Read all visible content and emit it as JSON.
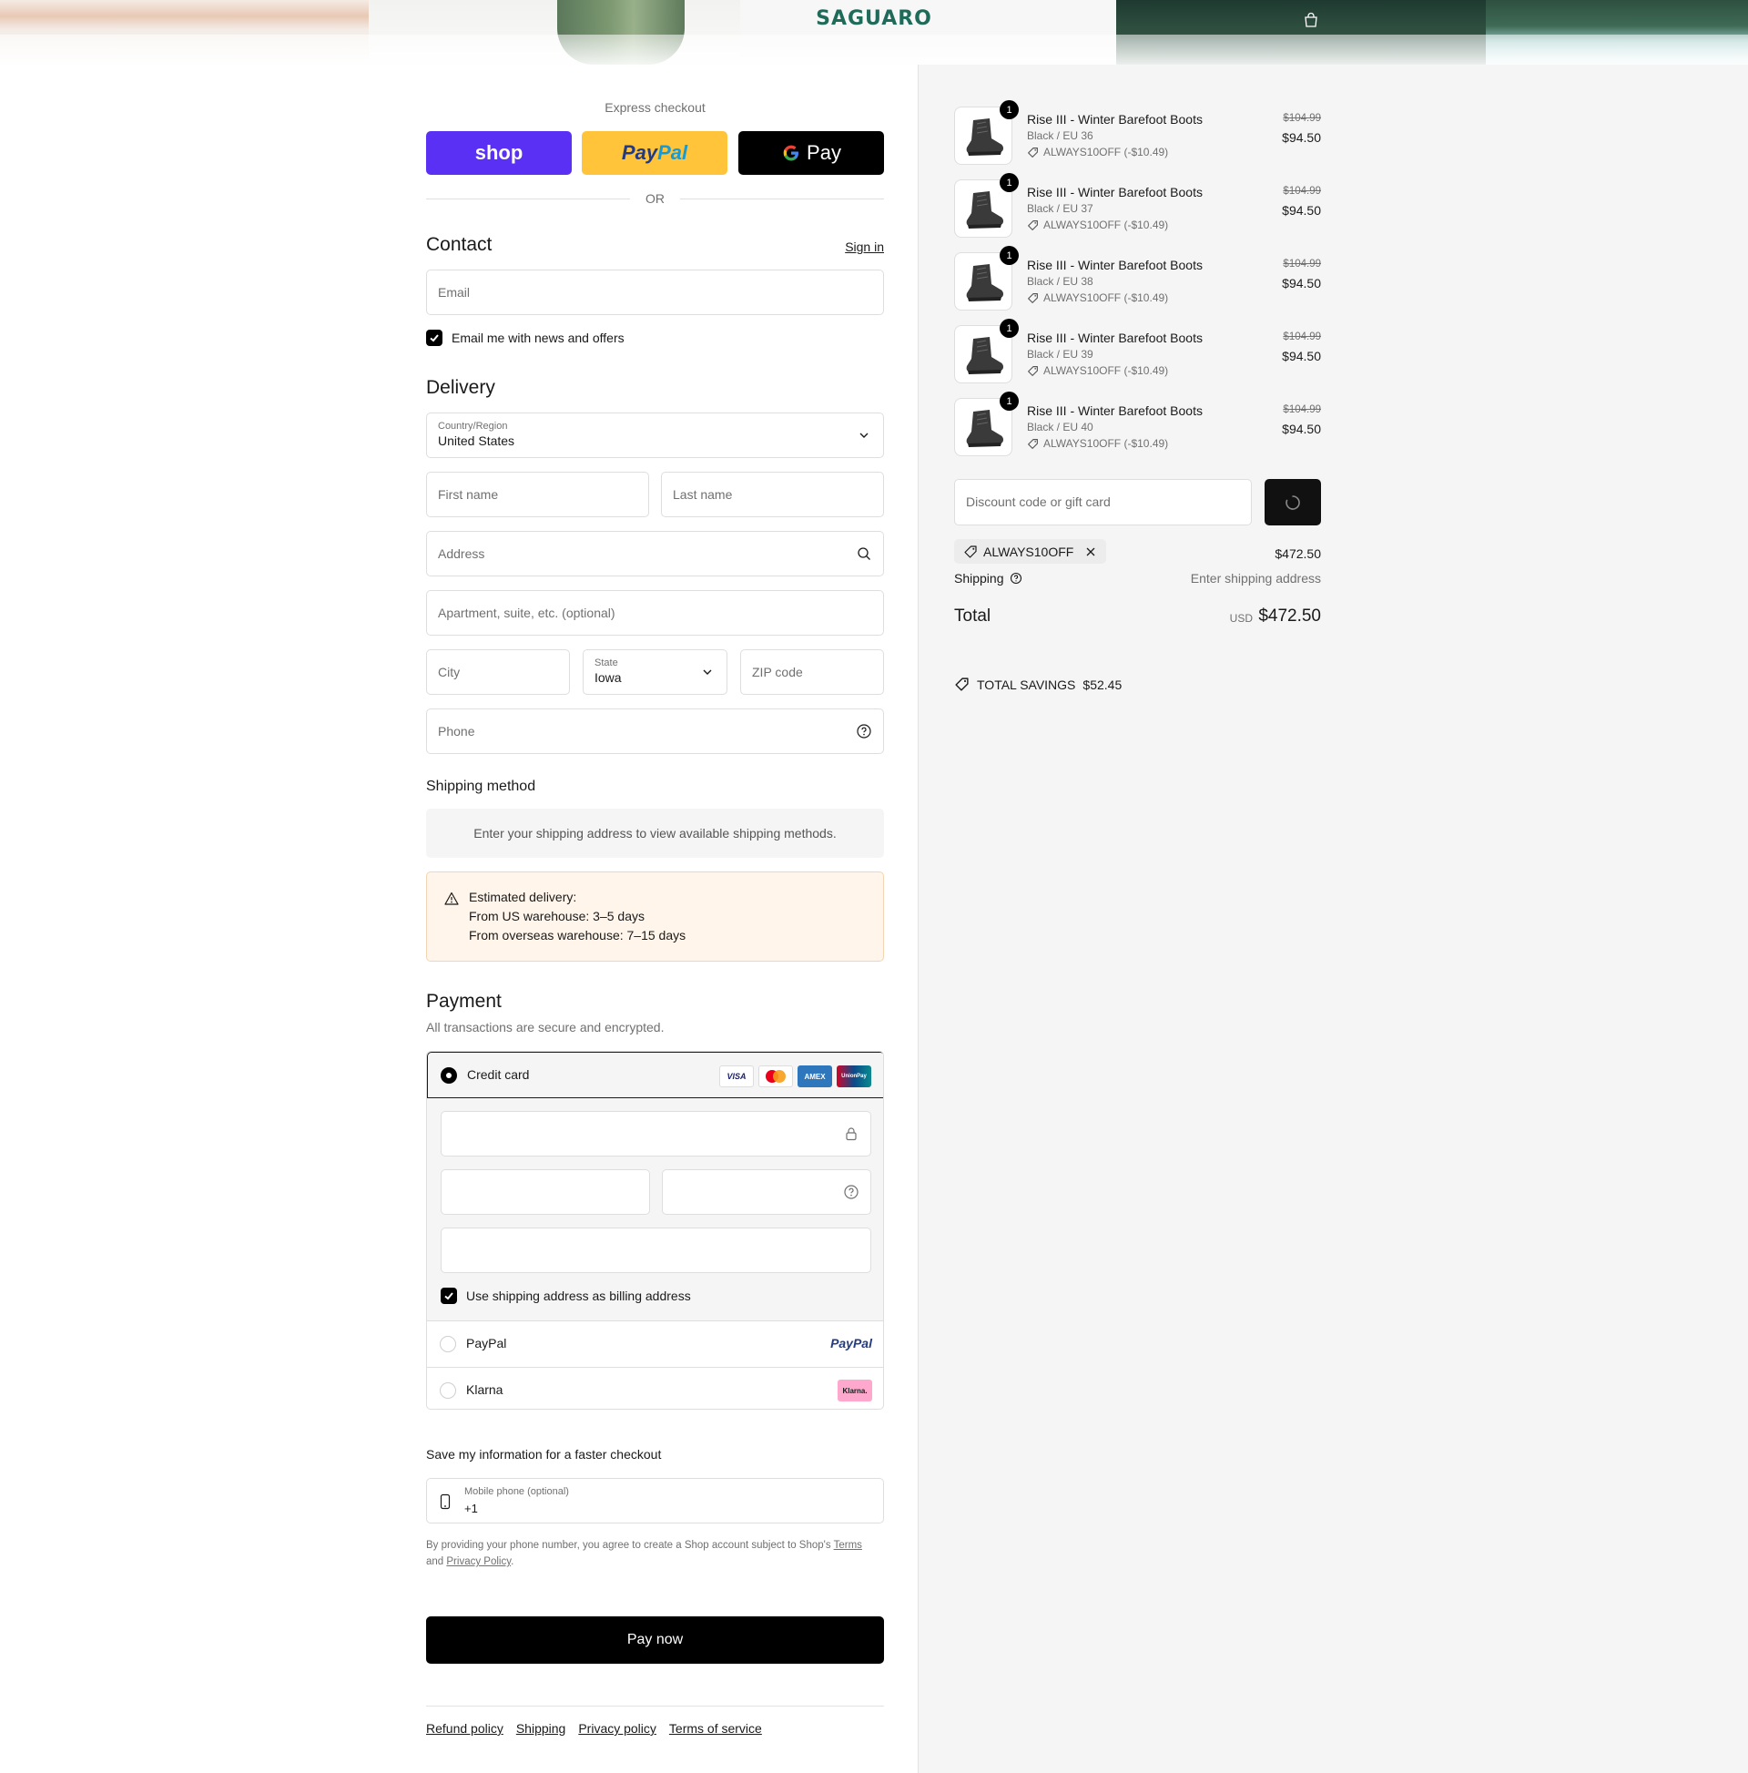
{
  "header": {
    "logo_text": "SAGUARO",
    "bag_icon": "shopping-bag-icon"
  },
  "express": {
    "title": "Express checkout",
    "shop_label": "shop",
    "paypal_label_1": "Pay",
    "paypal_label_2": "Pal",
    "gpay_label": "Pay",
    "or_label": "OR"
  },
  "contact": {
    "title": "Contact",
    "signin_label": "Sign in",
    "email_placeholder": "Email",
    "newsletter_label": "Email me with news and offers",
    "newsletter_checked": true
  },
  "delivery": {
    "title": "Delivery",
    "country_label": "Country/Region",
    "country_value": "United States",
    "first_name_placeholder": "First name",
    "last_name_placeholder": "Last name",
    "address_placeholder": "Address",
    "apartment_placeholder": "Apartment, suite, etc. (optional)",
    "city_placeholder": "City",
    "state_label": "State",
    "state_value": "Iowa",
    "zip_placeholder": "ZIP code",
    "phone_placeholder": "Phone"
  },
  "shipping_method": {
    "title": "Shipping method",
    "info": "Enter your shipping address to view available shipping methods."
  },
  "estimated": {
    "line1": "Estimated delivery:",
    "line2": "From US warehouse: 3–5 days",
    "line3": "From overseas warehouse: 7–15 days"
  },
  "payment": {
    "title": "Payment",
    "subtitle": "All transactions are secure and encrypted.",
    "credit_card_label": "Credit card",
    "card_logos": [
      "VISA",
      "MC",
      "AMEX",
      "UnionPay"
    ],
    "billing_label": "Use shipping address as billing address",
    "paypal_label": "PayPal",
    "paypal_logo": "PayPal",
    "klarna_label": "Klarna",
    "klarna_logo": "Klarna."
  },
  "save_info": {
    "title": "Save my information for a faster checkout",
    "phone_label": "Mobile phone (optional)",
    "phone_value": "+1",
    "disclaimer_1": "By providing your phone number, you agree to create a Shop account subject to Shop's",
    "terms": "Terms",
    "and": "and",
    "privacy": "Privacy Policy",
    "period": "."
  },
  "pay_now_label": "Pay now",
  "footer": {
    "links": [
      "Refund policy",
      "Shipping",
      "Privacy policy",
      "Terms of service"
    ]
  },
  "order": {
    "items": [
      {
        "qty": "1",
        "name": "Rise III - Winter Barefoot Boots",
        "variant": "Black / EU 36",
        "discount": "ALWAYS10OFF (-$10.49)",
        "old_price": "$104.99",
        "price": "$94.50"
      },
      {
        "qty": "1",
        "name": "Rise III - Winter Barefoot Boots",
        "variant": "Black / EU 37",
        "discount": "ALWAYS10OFF (-$10.49)",
        "old_price": "$104.99",
        "price": "$94.50"
      },
      {
        "qty": "1",
        "name": "Rise III - Winter Barefoot Boots",
        "variant": "Black / EU 38",
        "discount": "ALWAYS10OFF (-$10.49)",
        "old_price": "$104.99",
        "price": "$94.50"
      },
      {
        "qty": "1",
        "name": "Rise III - Winter Barefoot Boots",
        "variant": "Black / EU 39",
        "discount": "ALWAYS10OFF (-$10.49)",
        "old_price": "$104.99",
        "price": "$94.50"
      },
      {
        "qty": "1",
        "name": "Rise III - Winter Barefoot Boots",
        "variant": "Black / EU 40",
        "discount": "ALWAYS10OFF (-$10.49)",
        "old_price": "$104.99",
        "price": "$94.50"
      }
    ],
    "discount_placeholder": "Discount code or gift card",
    "applied_code": "ALWAYS10OFF",
    "subtotal": "$472.50",
    "shipping_label": "Shipping",
    "shipping_value": "Enter shipping address",
    "total_label": "Total",
    "total_currency": "USD",
    "total_value": "$472.50",
    "savings_label": "TOTAL SAVINGS",
    "savings_value": "$52.45"
  },
  "colors": {
    "shop_purple": "#5a31f4",
    "paypal_yellow": "#ffc439",
    "logo_green": "#1f6b5a",
    "estimate_bg": "#fff5ea"
  }
}
